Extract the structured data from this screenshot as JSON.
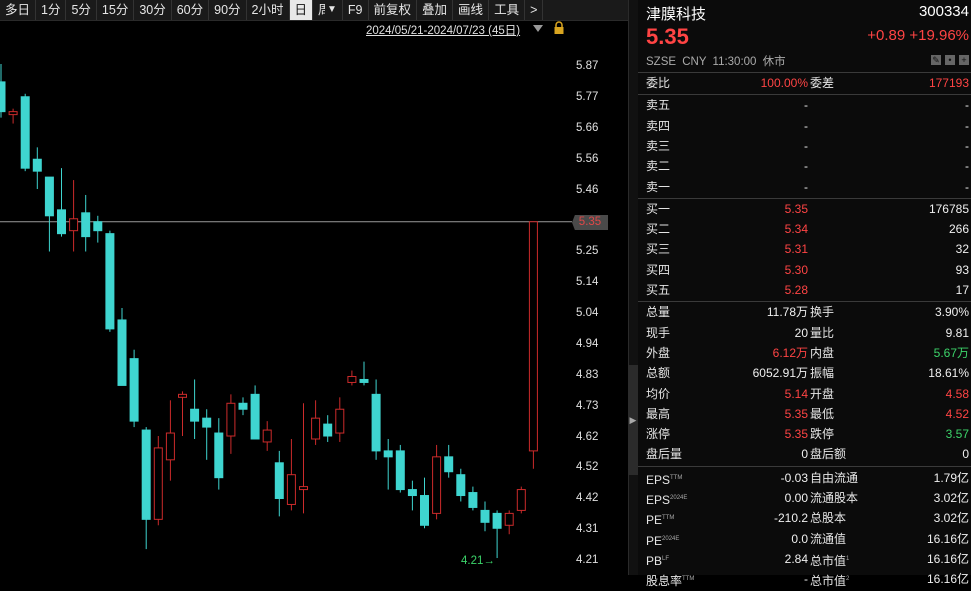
{
  "toolbar": {
    "buttons": [
      "多日",
      "1分",
      "5分",
      "15分",
      "30分",
      "60分",
      "90分",
      "2小时",
      "日",
      "周",
      "F9",
      "前复权",
      "叠加",
      "画线",
      "工具",
      ">"
    ],
    "active": "日"
  },
  "range_label": "2024/05/21-2024/07/23 (45日)",
  "y_ticks": [
    "5.87",
    "5.77",
    "5.66",
    "5.56",
    "5.46",
    "5.35",
    "5.25",
    "5.14",
    "5.04",
    "4.94",
    "4.83",
    "4.73",
    "4.62",
    "4.52",
    "4.42",
    "4.31",
    "4.21"
  ],
  "current_price_tag": "5.35",
  "low_label": "4.21",
  "colors": {
    "up": "#cc2b2b",
    "down": "#3fd5d0",
    "price_red": "#ff4444",
    "price_green": "#3cd46a"
  },
  "chart_data": {
    "type": "candlestick",
    "ylim": [
      4.21,
      5.92
    ],
    "candles": [
      {
        "o": 5.82,
        "h": 5.88,
        "l": 5.7,
        "c": 5.72
      },
      {
        "o": 5.71,
        "h": 5.73,
        "l": 5.68,
        "c": 5.72
      },
      {
        "o": 5.77,
        "h": 5.78,
        "l": 5.52,
        "c": 5.53
      },
      {
        "o": 5.56,
        "h": 5.6,
        "l": 5.46,
        "c": 5.52
      },
      {
        "o": 5.5,
        "h": 5.5,
        "l": 5.25,
        "c": 5.37
      },
      {
        "o": 5.39,
        "h": 5.53,
        "l": 5.3,
        "c": 5.31
      },
      {
        "o": 5.32,
        "h": 5.49,
        "l": 5.25,
        "c": 5.36
      },
      {
        "o": 5.38,
        "h": 5.44,
        "l": 5.25,
        "c": 5.3
      },
      {
        "o": 5.35,
        "h": 5.37,
        "l": 5.28,
        "c": 5.32
      },
      {
        "o": 5.31,
        "h": 5.32,
        "l": 4.98,
        "c": 4.99
      },
      {
        "o": 5.02,
        "h": 5.06,
        "l": 4.8,
        "c": 4.8
      },
      {
        "o": 4.89,
        "h": 4.92,
        "l": 4.66,
        "c": 4.68
      },
      {
        "o": 4.65,
        "h": 4.66,
        "l": 4.25,
        "c": 4.35
      },
      {
        "o": 4.35,
        "h": 4.63,
        "l": 4.33,
        "c": 4.59
      },
      {
        "o": 4.55,
        "h": 4.75,
        "l": 4.48,
        "c": 4.64
      },
      {
        "o": 4.76,
        "h": 4.78,
        "l": 4.63,
        "c": 4.77
      },
      {
        "o": 4.72,
        "h": 4.82,
        "l": 4.62,
        "c": 4.68
      },
      {
        "o": 4.69,
        "h": 4.72,
        "l": 4.55,
        "c": 4.66
      },
      {
        "o": 4.64,
        "h": 4.69,
        "l": 4.45,
        "c": 4.49
      },
      {
        "o": 4.63,
        "h": 4.77,
        "l": 4.57,
        "c": 4.74
      },
      {
        "o": 4.74,
        "h": 4.76,
        "l": 4.7,
        "c": 4.72
      },
      {
        "o": 4.77,
        "h": 4.8,
        "l": 4.62,
        "c": 4.62
      },
      {
        "o": 4.61,
        "h": 4.68,
        "l": 4.58,
        "c": 4.65
      },
      {
        "o": 4.54,
        "h": 4.58,
        "l": 4.36,
        "c": 4.42
      },
      {
        "o": 4.4,
        "h": 4.62,
        "l": 4.38,
        "c": 4.5
      },
      {
        "o": 4.45,
        "h": 4.74,
        "l": 4.37,
        "c": 4.46
      },
      {
        "o": 4.62,
        "h": 4.75,
        "l": 4.6,
        "c": 4.69
      },
      {
        "o": 4.67,
        "h": 4.7,
        "l": 4.61,
        "c": 4.63
      },
      {
        "o": 4.64,
        "h": 4.76,
        "l": 4.61,
        "c": 4.72
      },
      {
        "o": 4.81,
        "h": 4.85,
        "l": 4.8,
        "c": 4.83
      },
      {
        "o": 4.82,
        "h": 4.88,
        "l": 4.8,
        "c": 4.81
      },
      {
        "o": 4.77,
        "h": 4.82,
        "l": 4.55,
        "c": 4.58
      },
      {
        "o": 4.58,
        "h": 4.62,
        "l": 4.45,
        "c": 4.56
      },
      {
        "o": 4.58,
        "h": 4.6,
        "l": 4.44,
        "c": 4.45
      },
      {
        "o": 4.45,
        "h": 4.48,
        "l": 4.38,
        "c": 4.43
      },
      {
        "o": 4.43,
        "h": 4.49,
        "l": 4.32,
        "c": 4.33
      },
      {
        "o": 4.37,
        "h": 4.6,
        "l": 4.35,
        "c": 4.56
      },
      {
        "o": 4.56,
        "h": 4.6,
        "l": 4.49,
        "c": 4.51
      },
      {
        "o": 4.5,
        "h": 4.52,
        "l": 4.41,
        "c": 4.43
      },
      {
        "o": 4.44,
        "h": 4.46,
        "l": 4.38,
        "c": 4.39
      },
      {
        "o": 4.38,
        "h": 4.41,
        "l": 4.31,
        "c": 4.34
      },
      {
        "o": 4.37,
        "h": 4.38,
        "l": 4.22,
        "c": 4.32
      },
      {
        "o": 4.33,
        "h": 4.38,
        "l": 4.3,
        "c": 4.37
      },
      {
        "o": 4.38,
        "h": 4.46,
        "l": 4.37,
        "c": 4.45
      },
      {
        "o": 4.58,
        "h": 5.35,
        "l": 4.52,
        "c": 5.35
      }
    ]
  },
  "quote": {
    "name": "津膜科技",
    "code": "300334",
    "price": "5.35",
    "change": "+0.89",
    "change_pct": "+19.96%",
    "exchange": "SZSE",
    "currency": "CNY",
    "time": "11:30:00",
    "status": "休市"
  },
  "order_book": {
    "weibi_label": "委比",
    "weibi": "100.00%",
    "weicha_label": "委差",
    "weicha": "177193",
    "asks": [
      {
        "label": "卖五",
        "price": "-",
        "vol": "-"
      },
      {
        "label": "卖四",
        "price": "-",
        "vol": "-"
      },
      {
        "label": "卖三",
        "price": "-",
        "vol": "-"
      },
      {
        "label": "卖二",
        "price": "-",
        "vol": "-"
      },
      {
        "label": "卖一",
        "price": "-",
        "vol": "-"
      }
    ],
    "bids": [
      {
        "label": "买一",
        "price": "5.35",
        "vol": "176785"
      },
      {
        "label": "买二",
        "price": "5.34",
        "vol": "266"
      },
      {
        "label": "买三",
        "price": "5.31",
        "vol": "32"
      },
      {
        "label": "买四",
        "price": "5.30",
        "vol": "93"
      },
      {
        "label": "买五",
        "price": "5.28",
        "vol": "17"
      }
    ]
  },
  "stats": [
    {
      "l1": "总量",
      "v1": "11.78万",
      "c1": "white",
      "l2": "换手",
      "v2": "3.90%",
      "c2": "white"
    },
    {
      "l1": "现手",
      "v1": "20",
      "c1": "white",
      "l2": "量比",
      "v2": "9.81",
      "c2": "white"
    },
    {
      "l1": "外盘",
      "v1": "6.12万",
      "c1": "red",
      "l2": "内盘",
      "v2": "5.67万",
      "c2": "green"
    },
    {
      "l1": "总额",
      "v1": "6052.91万",
      "c1": "white",
      "l2": "振幅",
      "v2": "18.61%",
      "c2": "white"
    },
    {
      "l1": "均价",
      "v1": "5.14",
      "c1": "red",
      "l2": "开盘",
      "v2": "4.58",
      "c2": "red"
    },
    {
      "l1": "最高",
      "v1": "5.35",
      "c1": "red",
      "l2": "最低",
      "v2": "4.52",
      "c2": "red"
    },
    {
      "l1": "涨停",
      "v1": "5.35",
      "c1": "red",
      "l2": "跌停",
      "v2": "3.57",
      "c2": "green"
    },
    {
      "l1": "盘后量",
      "v1": "0",
      "c1": "white",
      "l2": "盘后额",
      "v2": "0",
      "c2": "white"
    }
  ],
  "fundamentals": [
    {
      "l1": "EPS",
      "s1": "TTM",
      "v1": "-0.03",
      "l2": "自由流通",
      "s2": "",
      "v2": "1.79亿"
    },
    {
      "l1": "EPS",
      "s1": "2024E",
      "v1": "0.00",
      "l2": "流通股本",
      "s2": "",
      "v2": "3.02亿"
    },
    {
      "l1": "PE",
      "s1": "TTM",
      "v1": "-210.2",
      "l2": "总股本",
      "s2": "",
      "v2": "3.02亿"
    },
    {
      "l1": "PE",
      "s1": "2024E",
      "v1": "0.0",
      "l2": "流通值",
      "s2": "",
      "v2": "16.16亿"
    },
    {
      "l1": "PB",
      "s1": "LF",
      "v1": "2.84",
      "l2": "总市值",
      "s2": "1",
      "v2": "16.16亿"
    },
    {
      "l1": "股息率",
      "s1": "TTM",
      "v1": "-",
      "l2": "总市值",
      "s2": "2",
      "v2": "16.16亿"
    }
  ]
}
